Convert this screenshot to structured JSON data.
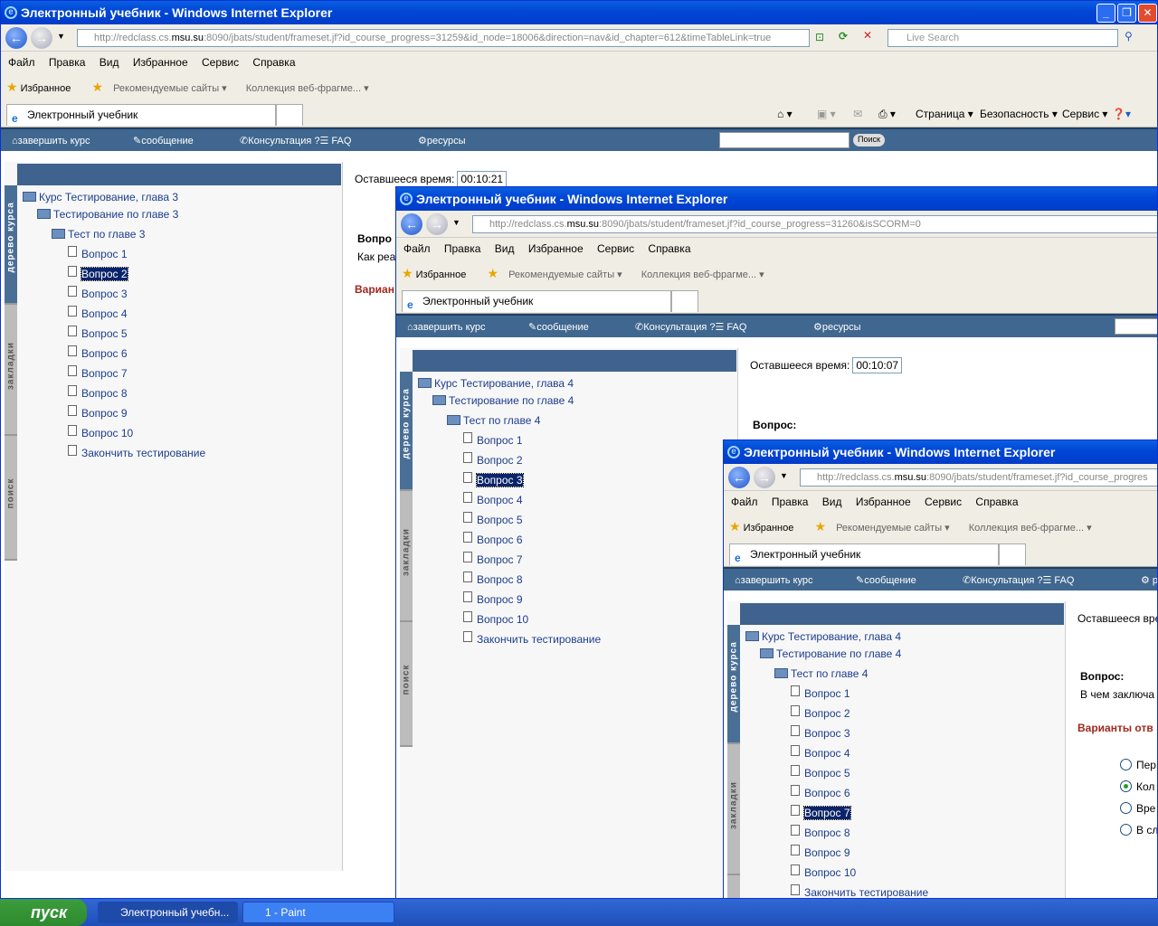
{
  "windows": [
    {
      "title": "Электронный учебник - Windows Internet Explorer",
      "url_pre": "http://redclass.cs.",
      "url_host": "msu.su",
      "url_post": ":8090/jbats/student/frameset.jf?id_course_progress=31259&id_node=18006&direction=nav&id_chapter=612&timeTableLink=true",
      "search_placeholder": "Live Search",
      "menu": [
        "Файл",
        "Правка",
        "Вид",
        "Избранное",
        "Сервис",
        "Справка"
      ],
      "favorites_label": "Избранное",
      "recommended_label": "Рекомендуемые сайты",
      "collection_label": "Коллекция веб-фрагме...",
      "tab_label": "Электронный учебник",
      "commands": [
        "Страница",
        "Безопасность",
        "Сервис"
      ],
      "appbar": {
        "finish": "завершить курс",
        "message": "сообщение",
        "consult": "Консультация ?☰ FAQ",
        "resources": "ресурсы",
        "search_button": "Поиск"
      },
      "sidetabs": [
        "дерево курса",
        "закладки",
        "поиск"
      ],
      "tree": {
        "course": "Курс Тестирование, глава 3",
        "chapter": "Тестирование по главе 3",
        "test": "Тест по главе 3",
        "questions": [
          "Вопрос 1",
          "Вопрос 2",
          "Вопрос 3",
          "Вопрос 4",
          "Вопрос 5",
          "Вопрос 6",
          "Вопрос 7",
          "Вопрос 8",
          "Вопрос 9",
          "Вопрос 10"
        ],
        "finish": "Закончить тестирование",
        "selected": 1
      },
      "timer_label": "Оставшееся время:",
      "timer_value": "00:10:21",
      "question_label": "Вопро",
      "question_text": "Как реа",
      "variants_label": "Вариан"
    },
    {
      "title": "Электронный учебник - Windows Internet Explorer",
      "url_pre": "http://redclass.cs.",
      "url_host": "msu.su",
      "url_post": ":8090/jbats/student/frameset.jf?id_course_progress=31260&isSCORM=0",
      "tree": {
        "course": "Курс Тестирование, глава 4",
        "chapter": "Тестирование по главе 4",
        "test": "Тест по главе 4",
        "selected": 2
      },
      "timer_value": "00:10:07",
      "question_label": "Вопрос:"
    },
    {
      "title": "Электронный учебник - Windows Internet Explorer",
      "url_pre": "http://redclass.cs.",
      "url_host": "msu.su",
      "url_post": ":8090/jbats/student/frameset.jf?id_course_progres",
      "tree": {
        "selected": 6
      },
      "timer_label": "Оставшееся вре",
      "question_label": "Вопрос:",
      "question_text": "В чем заключа",
      "variants_label": "Варианты отв",
      "options": [
        "Пер",
        "Кол",
        "Вре",
        "В сл"
      ],
      "checked_option": 1
    }
  ],
  "taskbar": {
    "start": "пуск",
    "items": [
      "Электронный учебн...",
      "1 - Paint"
    ]
  }
}
